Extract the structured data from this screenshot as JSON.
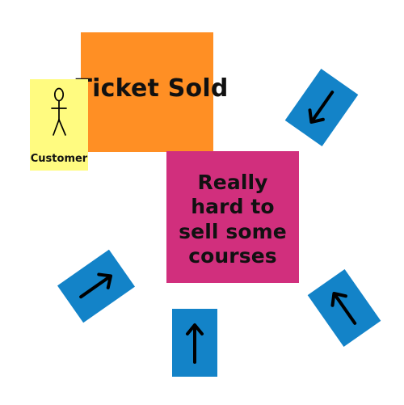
{
  "notes": {
    "ticket_sold": "Ticket Sold",
    "customer": "Customer",
    "really_hard": "Really hard to sell some courses"
  },
  "colors": {
    "orange_note": "#ff8f24",
    "yellow_note": "#fffb80",
    "magenta_note": "#d12f7d",
    "blue_note": "#1383c8"
  },
  "icons": [
    "stick-figure-icon",
    "arrow-icon"
  ]
}
